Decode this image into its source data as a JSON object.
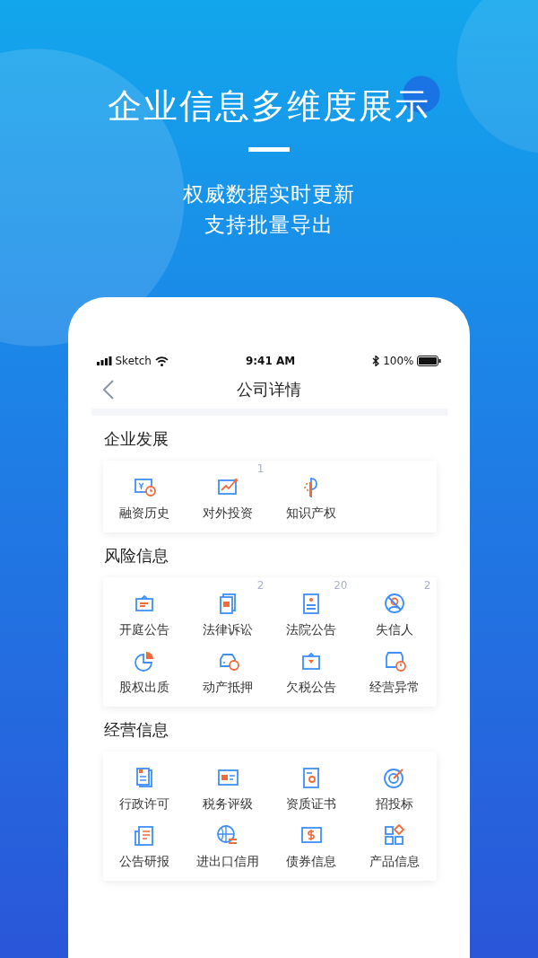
{
  "hero": {
    "title": "企业信息多维度展示",
    "subtitle_lines": [
      "权威数据实时更新",
      "支持批量导出"
    ]
  },
  "status_bar": {
    "carrier": "Sketch",
    "time": "9:41 AM",
    "battery": "100%"
  },
  "nav": {
    "title": "公司详情"
  },
  "sections": [
    {
      "title": "企业发展",
      "items": [
        {
          "label": "融资历史"
        },
        {
          "label": "对外投资",
          "count": "1"
        },
        {
          "label": "知识产权"
        }
      ]
    },
    {
      "title": "风险信息",
      "items": [
        {
          "label": "开庭公告"
        },
        {
          "label": "法律诉讼",
          "count": "2"
        },
        {
          "label": "法院公告",
          "count": "20"
        },
        {
          "label": "失信人",
          "count": "2"
        },
        {
          "label": "股权出质"
        },
        {
          "label": "动产抵押"
        },
        {
          "label": "欠税公告"
        },
        {
          "label": "经营异常"
        }
      ]
    },
    {
      "title": "经营信息",
      "items": [
        {
          "label": "行政许可"
        },
        {
          "label": "税务评级"
        },
        {
          "label": "资质证书"
        },
        {
          "label": "招投标"
        },
        {
          "label": "公告研报"
        },
        {
          "label": "进出口信用"
        },
        {
          "label": "债券信息"
        },
        {
          "label": "产品信息"
        }
      ]
    }
  ]
}
